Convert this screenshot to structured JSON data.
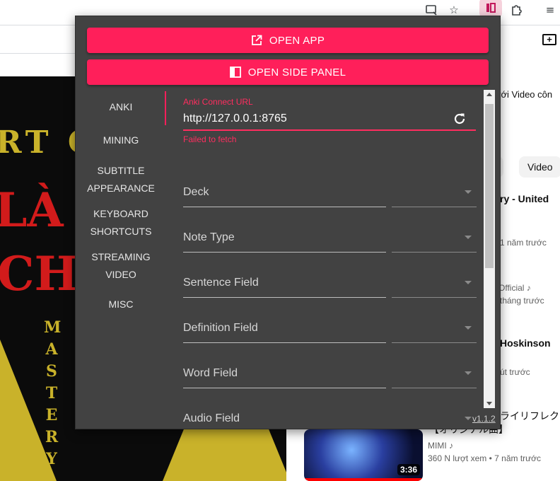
{
  "browser": {
    "toolbar_icons": [
      "screen-share-icon",
      "star-icon",
      "extension-active-icon",
      "puzzle-icon",
      "playlist-icon"
    ]
  },
  "background": {
    "poster": {
      "line1": "RT G",
      "line2": "LÀ",
      "line3": "CH",
      "vertical": "MASTERY"
    },
    "right_pane": {
      "heading_fragment": "với Video côn",
      "chip_left": ".",
      "chip_right": "Video",
      "item1_title": "ry - United",
      "item1_meta": "1 năm trước",
      "item2_title": "Official ♪",
      "item2_meta": "tháng trước",
      "item3_title": "Hoskinson",
      "item3_meta": "út trước",
      "item4_title": "ライリフレク",
      "item4_subtitle": "【オリジナル曲】",
      "item4_channel": "MIMI ♪",
      "item4_meta": "360 N lượt xem • 7 năm trước",
      "thumb_duration": "3:36"
    }
  },
  "popup": {
    "buttons": {
      "open_app": "OPEN APP",
      "open_side_panel": "OPEN SIDE PANEL"
    },
    "tabs": [
      {
        "id": "anki",
        "line1": "ANKI",
        "line2": ""
      },
      {
        "id": "mining",
        "line1": "MINING",
        "line2": ""
      },
      {
        "id": "subtitle-appearance",
        "line1": "SUBTITLE",
        "line2": "APPEARANCE"
      },
      {
        "id": "keyboard-shortcuts",
        "line1": "KEYBOARD",
        "line2": "SHORTCUTS"
      },
      {
        "id": "streaming-video",
        "line1": "STREAMING",
        "line2": "VIDEO"
      },
      {
        "id": "misc",
        "line1": "MISC",
        "line2": ""
      }
    ],
    "active_tab": "anki",
    "anki_connect": {
      "label": "Anki Connect URL",
      "value": "http://127.0.0.1:8765",
      "error": "Failed to fetch"
    },
    "fields": [
      {
        "label": "Deck",
        "value": ""
      },
      {
        "label": "Note Type",
        "value": ""
      },
      {
        "label": "Sentence Field",
        "value": ""
      },
      {
        "label": "Definition Field",
        "value": ""
      },
      {
        "label": "Word Field",
        "value": ""
      },
      {
        "label": "Audio Field",
        "value": ""
      }
    ],
    "version": "v1.1.2",
    "accent_color": "#ff1f5a",
    "background_color": "#424242"
  }
}
